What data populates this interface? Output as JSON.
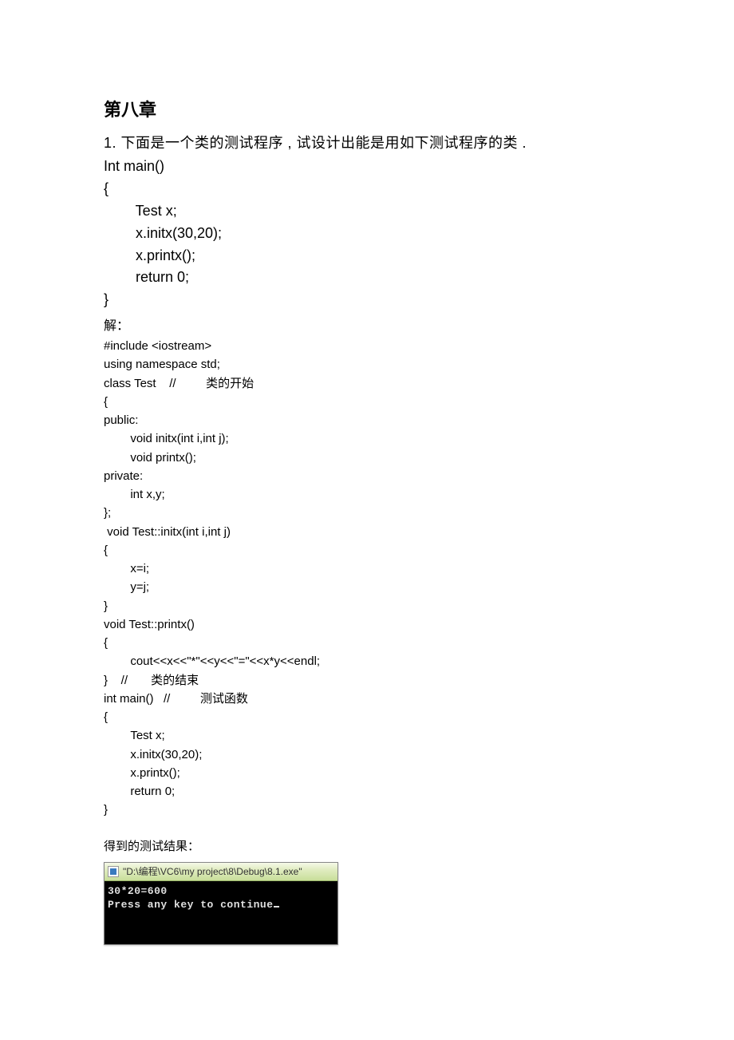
{
  "chapter_title": "第八章",
  "problem": "1. 下面是一个类的测试程序   , 试设计出能是用如下测试程序的类    .",
  "main_intro": "Int main()\n{\n        Test x;\n        x.initx(30,20);\n        x.printx();\n        return 0;\n}",
  "solution_label": "解：",
  "code": "#include <iostream>\nusing namespace std;\nclass Test    //         类的开始\n{\npublic:\n        void initx(int i,int j);\n        void printx();\nprivate:\n        int x,y;\n};\n void Test::initx(int i,int j)\n{\n        x=i;\n        y=j;\n}\nvoid Test::printx()\n{\n        cout<<x<<\"*\"<<y<<\"=\"<<x*y<<endl;\n}    //       类的结束\nint main()   //         测试函数\n{\n        Test x;\n        x.initx(30,20);\n        x.printx();\n        return 0;\n}",
  "result_label": "得到的测试结果：",
  "console": {
    "title": "\"D:\\编程\\VC6\\my project\\8\\Debug\\8.1.exe\"",
    "line1": "30*20=600",
    "line2": "Press any key to continue"
  }
}
